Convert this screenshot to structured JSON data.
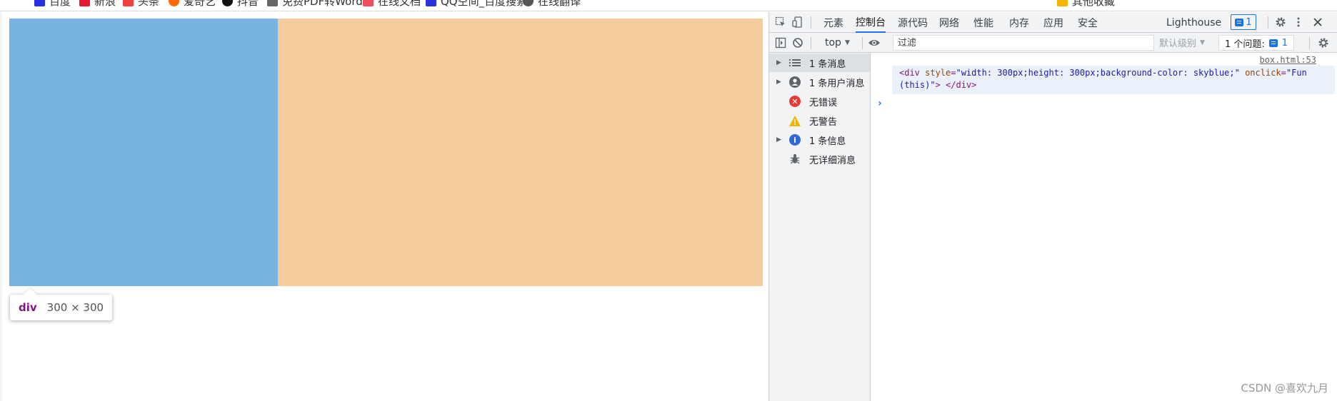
{
  "bookmarks": [
    {
      "label": "百度",
      "color": "#2932e1"
    },
    {
      "label": "新浪",
      "color": "#e6162d"
    },
    {
      "label": "头条",
      "color": "#f04142"
    },
    {
      "label": "爱奇艺",
      "color": "#ff6a00"
    },
    {
      "label": "抖音",
      "color": "#111111"
    },
    {
      "label": "免费PDF转Word",
      "color": "#666666"
    },
    {
      "label": "在线文档",
      "color": "#ee4e5e"
    },
    {
      "label": "QQ空间_百度搜索",
      "color": "#2932e1"
    },
    {
      "label": "在线翻译",
      "color": "#555555"
    },
    {
      "label": "其他收藏",
      "color": "#f4b400"
    }
  ],
  "page": {
    "tooltip": {
      "tag": "div",
      "dims": "300 × 300"
    }
  },
  "devtools": {
    "tabs": [
      "元素",
      "控制台",
      "源代码",
      "网络",
      "性能",
      "内存",
      "应用",
      "安全",
      "Lighthouse"
    ],
    "active_tab": "控制台",
    "issues_badge": "1",
    "context": "top",
    "filter_placeholder": "过滤",
    "levels": "默认级别",
    "issues_count": "1 个问题:",
    "issues_count_n": "1",
    "sidebar": [
      {
        "label": "1 条消息",
        "icon": "list-icon",
        "expandable": true,
        "selected": true
      },
      {
        "label": "1 条用户消息",
        "icon": "user-icon",
        "expandable": true,
        "selected": false
      },
      {
        "label": "无错误",
        "icon": "error-icon",
        "expandable": false,
        "selected": false
      },
      {
        "label": "无警告",
        "icon": "warning-icon",
        "expandable": false,
        "selected": false
      },
      {
        "label": "1 条信息",
        "icon": "info-icon",
        "expandable": true,
        "selected": false
      },
      {
        "label": "无详细消息",
        "icon": "bug-icon",
        "expandable": false,
        "selected": false
      }
    ],
    "console": {
      "source": "box.html:53",
      "line1": {
        "open": "<div ",
        "style_attr": "style",
        "style_val": "\"width: 300px;height: 300px;background-color: skyblue;\"",
        "onclick_attr": " onclick",
        "onclick_val": "\"Fun"
      },
      "line2": {
        "cont": "(this)\"",
        "close": "> </div>"
      },
      "prompt": "›"
    }
  },
  "watermark": "CSDN @喜欢九月"
}
